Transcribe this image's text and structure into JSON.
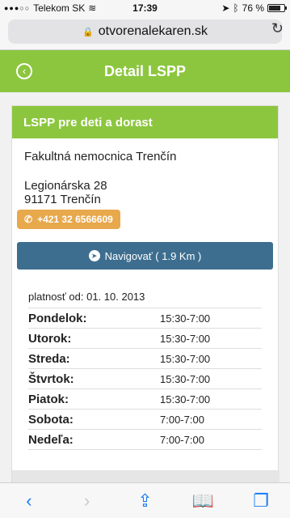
{
  "status": {
    "carrier": "Telekom SK",
    "time": "17:39",
    "battery": "76 %",
    "battery_level": 0.76
  },
  "browser": {
    "url": "otvorenalekaren.sk"
  },
  "header": {
    "title": "Detail LSPP"
  },
  "card": {
    "title": "LSPP pre deti a dorast",
    "hospital": "Fakultná nemocnica Trenčín",
    "address_line1": "Legionárska  28",
    "address_line2": "91171  Trenčín",
    "phone": "+421 32 6566609",
    "navigate": "Navigovať ( 1.9 Km )",
    "valid_from": "platnosť od: 01. 10. 2013",
    "hours": [
      {
        "day": "Pondelok:",
        "time": "15:30-7:00"
      },
      {
        "day": "Utorok:",
        "time": "15:30-7:00"
      },
      {
        "day": "Streda:",
        "time": "15:30-7:00"
      },
      {
        "day": "Štvrtok:",
        "time": "15:30-7:00"
      },
      {
        "day": "Piatok:",
        "time": "15:30-7:00"
      },
      {
        "day": "Sobota:",
        "time": "7:00-7:00"
      },
      {
        "day": "Nedeľa:",
        "time": "7:00-7:00"
      }
    ]
  },
  "colors": {
    "green": "#8cc63f",
    "navigate_blue": "#3d6e8f",
    "phone_orange": "#e8a84c",
    "ios_blue": "#1a7cf7"
  }
}
